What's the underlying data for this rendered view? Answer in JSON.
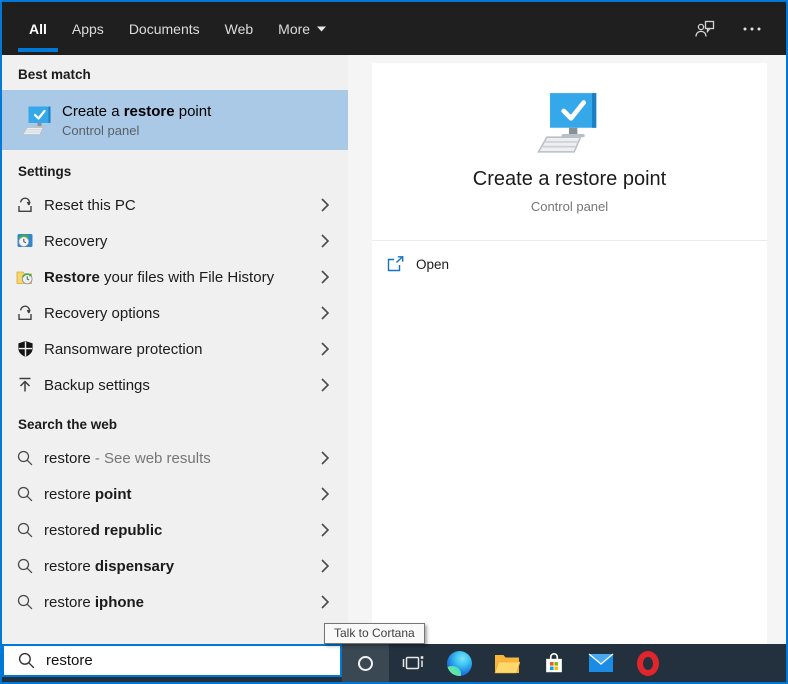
{
  "header": {
    "tabs": [
      {
        "label": "All",
        "active": true
      },
      {
        "label": "Apps",
        "active": false
      },
      {
        "label": "Documents",
        "active": false
      },
      {
        "label": "Web",
        "active": false
      },
      {
        "label": "More",
        "active": false
      }
    ],
    "icons": [
      "user-feedback-icon",
      "more-options-icon"
    ]
  },
  "colors": {
    "accent": "#0078d7",
    "highlight": "#a9c9e7",
    "header_bg": "#1f1f1f",
    "taskbar_bg": "#22313d",
    "left_panel_bg": "#f0f0f0"
  },
  "best_match": {
    "header": "Best match",
    "item": {
      "icon": "restore-point-computer-icon",
      "title_pre": "Create a ",
      "title_bold": "restore",
      "title_post": " point",
      "subtitle": "Control panel"
    }
  },
  "settings": {
    "header": "Settings",
    "items": [
      {
        "icon": "reset-icon",
        "pre": "Reset this PC",
        "bold": "",
        "post": ""
      },
      {
        "icon": "recovery-icon",
        "pre": "Recovery",
        "bold": "",
        "post": ""
      },
      {
        "icon": "file-history-icon",
        "pre": "",
        "bold": "Restore",
        "post": " your files with File History"
      },
      {
        "icon": "reset-icon",
        "pre": "Recovery options",
        "bold": "",
        "post": ""
      },
      {
        "icon": "shield-icon",
        "pre": "Ransomware protection",
        "bold": "",
        "post": ""
      },
      {
        "icon": "backup-icon",
        "pre": "Backup settings",
        "bold": "",
        "post": ""
      }
    ]
  },
  "web_search": {
    "header": "Search the web",
    "items": [
      {
        "icon": "search-icon",
        "pre": "restore",
        "bold": "",
        "muted": " - See web results"
      },
      {
        "icon": "search-icon",
        "pre": "restore ",
        "bold": "point",
        "muted": ""
      },
      {
        "icon": "search-icon",
        "pre": "restore",
        "bold": "d republic",
        "muted": ""
      },
      {
        "icon": "search-icon",
        "pre": "restore ",
        "bold": "dispensary",
        "muted": ""
      },
      {
        "icon": "search-icon",
        "pre": "restore ",
        "bold": "iphone",
        "muted": ""
      }
    ]
  },
  "preview": {
    "icon": "restore-point-computer-icon",
    "title": "Create a restore point",
    "subtitle": "Control panel",
    "open_label": "Open"
  },
  "tooltip": {
    "text": "Talk to Cortana"
  },
  "taskbar": {
    "search_value": "restore",
    "icons": [
      "cortana",
      "task-view",
      "edge",
      "file-explorer",
      "store",
      "mail",
      "opera"
    ]
  }
}
